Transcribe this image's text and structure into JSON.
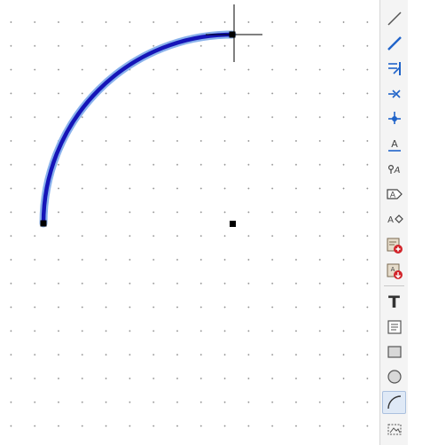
{
  "editor": {
    "canvas": {
      "grid_dot_color": "#8a8a8a",
      "arc_color": "#1515b8",
      "arc_highlight": "#8ab2ec"
    },
    "right_toolbar": {
      "tools": [
        {
          "icon": "line-icon",
          "state": "normal"
        },
        {
          "icon": "wire-icon",
          "state": "normal"
        },
        {
          "icon": "bus-entry-icon",
          "state": "normal"
        },
        {
          "icon": "no-connect-icon",
          "state": "normal"
        },
        {
          "icon": "junction-icon",
          "state": "normal"
        },
        {
          "icon": "net-label-icon",
          "state": "normal"
        },
        {
          "icon": "global-label-icon",
          "state": "normal"
        },
        {
          "icon": "hierarchical-label-icon",
          "state": "normal"
        },
        {
          "icon": "hierarchical-pin-icon",
          "state": "normal"
        },
        {
          "icon": "add-sheet-icon",
          "state": "normal"
        },
        {
          "icon": "import-sheet-pin-icon",
          "state": "normal"
        },
        {
          "icon": "text-icon",
          "state": "normal"
        },
        {
          "icon": "text-box-icon",
          "state": "normal"
        },
        {
          "icon": "rectangle-icon",
          "state": "normal"
        },
        {
          "icon": "circle-icon",
          "state": "normal"
        },
        {
          "icon": "arc-icon",
          "state": "active"
        },
        {
          "icon": "image-icon",
          "state": "normal"
        }
      ],
      "text_tool_glyph": "T",
      "label_glyph": "A",
      "global_label_glyph": "A"
    }
  }
}
